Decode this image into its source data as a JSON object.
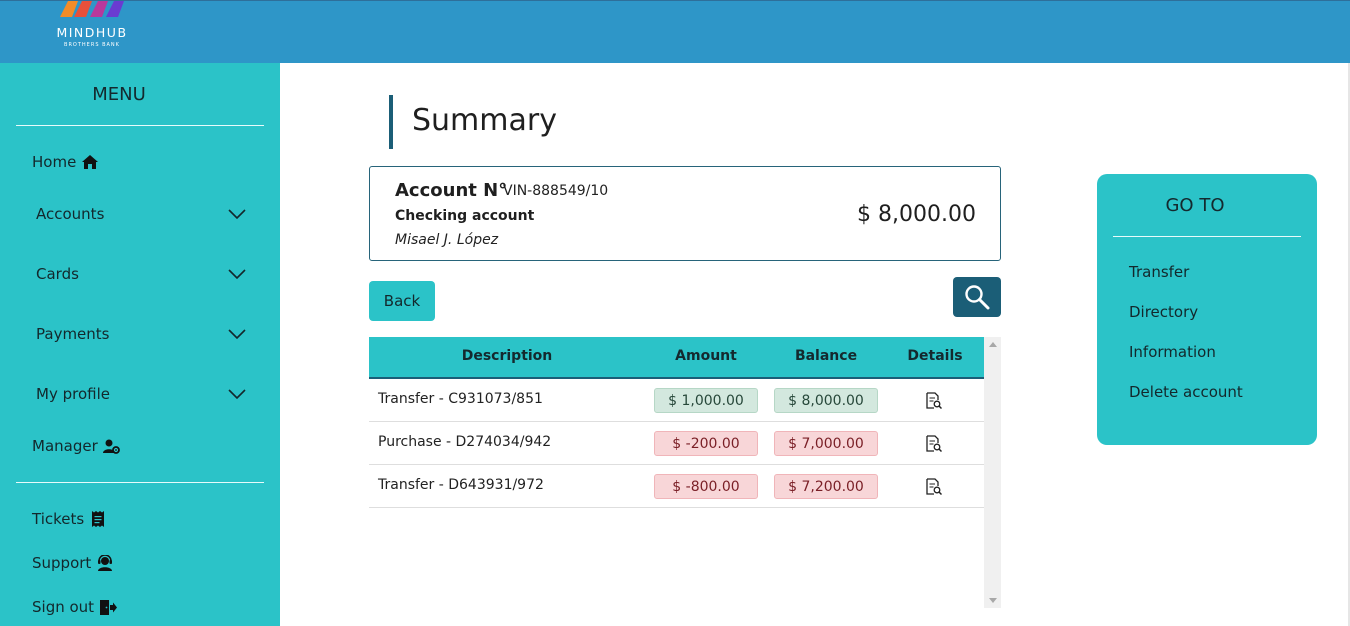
{
  "brand": {
    "name": "MINDHUB",
    "subtitle": "BROTHERS BANK",
    "colors": {
      "header": "#2e96c8",
      "accent": "#2bc3c8",
      "dark": "#1b5e77",
      "positive_bg": "#d3e8de",
      "negative_bg": "#f8d6d8"
    }
  },
  "sidebar": {
    "title": "MENU",
    "items": [
      {
        "label": "Home",
        "icon": "home-icon"
      },
      {
        "label": "Accounts",
        "icon": "chevron-down-icon"
      },
      {
        "label": "Cards",
        "icon": "chevron-down-icon"
      },
      {
        "label": "Payments",
        "icon": "chevron-down-icon"
      },
      {
        "label": "My profile",
        "icon": "chevron-down-icon"
      },
      {
        "label": "Manager",
        "icon": "user-gear-icon"
      },
      {
        "label": "Tickets",
        "icon": "receipt-icon"
      },
      {
        "label": "Support",
        "icon": "headset-icon"
      },
      {
        "label": "Sign out",
        "icon": "sign-out-icon"
      }
    ]
  },
  "main": {
    "title": "Summary",
    "account": {
      "label": "Account N°",
      "number": "VIN-888549/10",
      "type": "Checking account",
      "holder": "Misael J. López",
      "balance": "$ 8,000.00"
    },
    "back_label": "Back",
    "search_icon": "search-icon",
    "table": {
      "headers": [
        "Description",
        "Amount",
        "Balance",
        "Details"
      ],
      "rows": [
        {
          "description": "Transfer - C931073/851",
          "amount": "$ 1,000.00",
          "balance": "$ 8,000.00",
          "status": "positive"
        },
        {
          "description": "Purchase - D274034/942",
          "amount": "$ -200.00",
          "balance": "$ 7,000.00",
          "status": "negative"
        },
        {
          "description": "Transfer - D643931/972",
          "amount": "$ -800.00",
          "balance": "$ 7,200.00",
          "status": "negative"
        }
      ]
    }
  },
  "goto": {
    "title": "GO TO",
    "links": [
      "Transfer",
      "Directory",
      "Information",
      "Delete account"
    ]
  }
}
